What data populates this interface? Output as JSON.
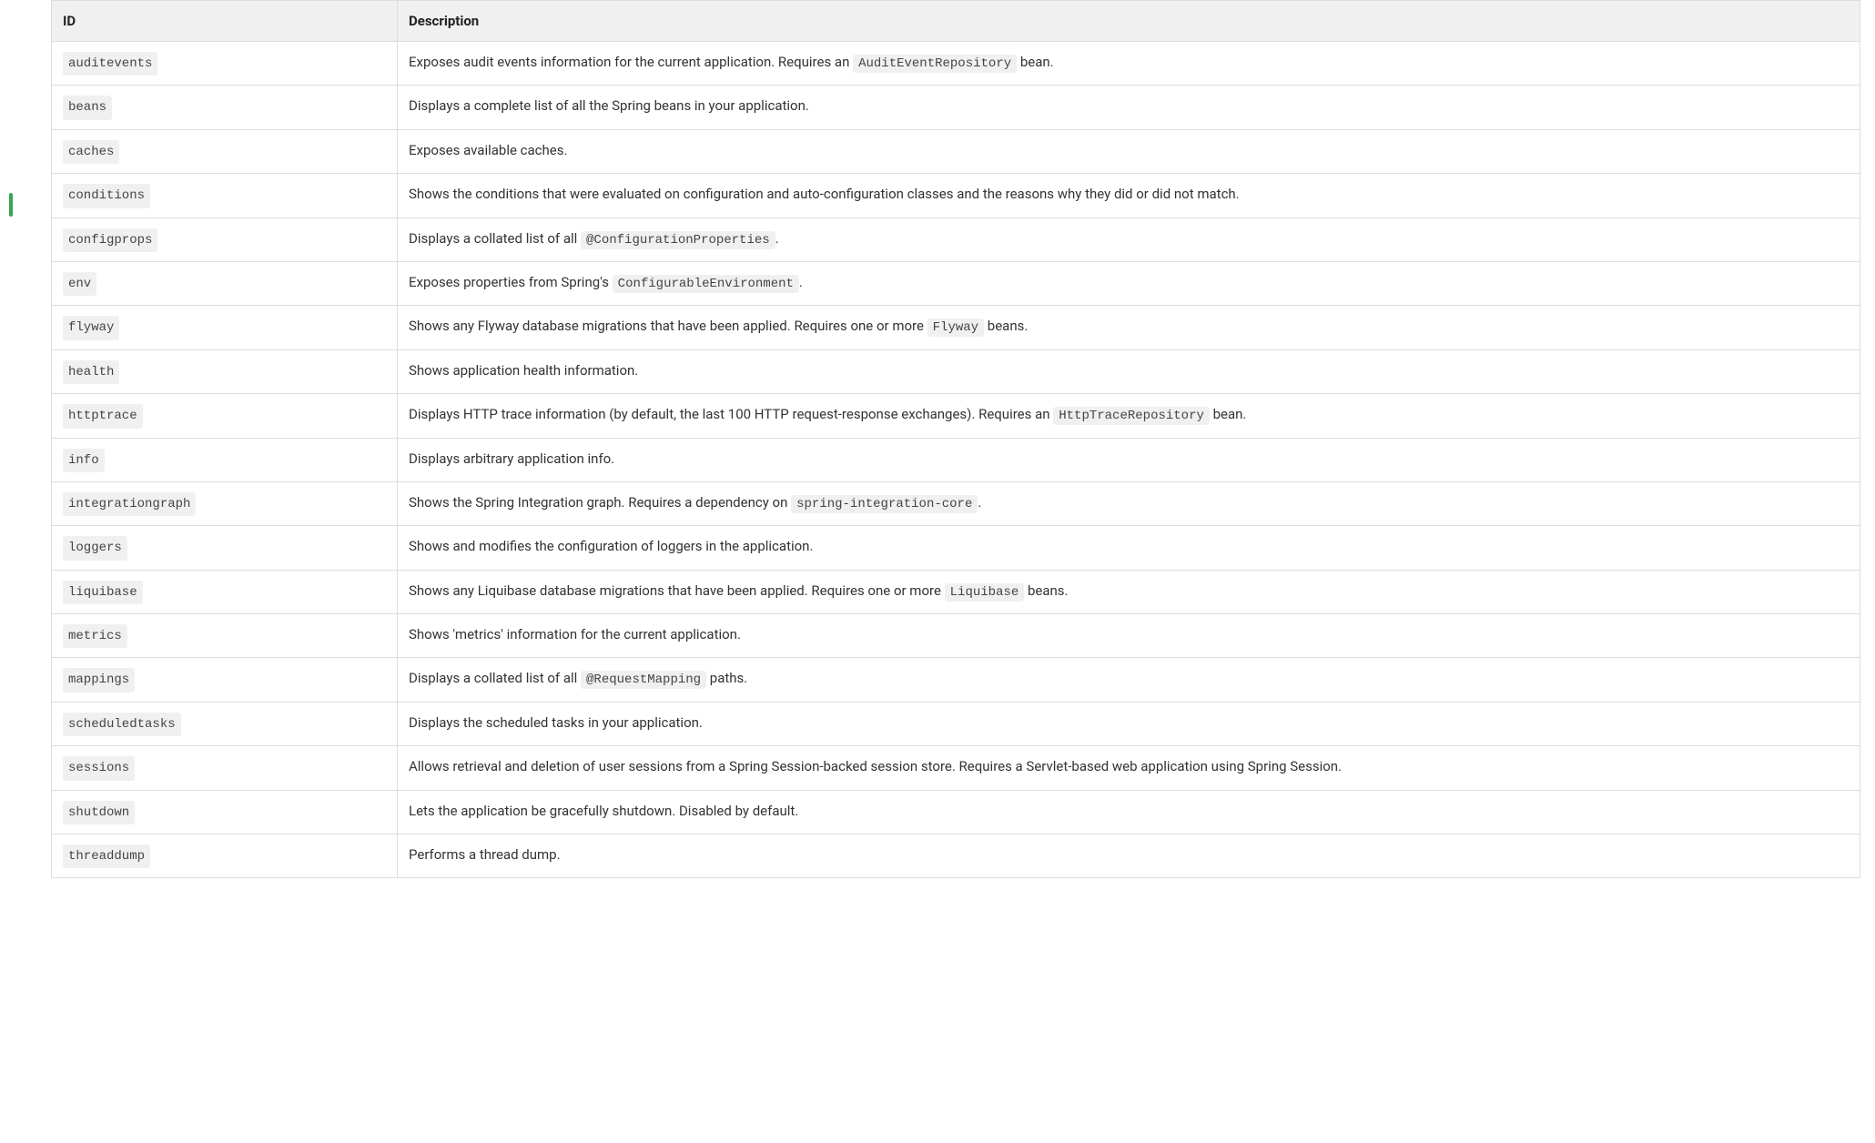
{
  "table": {
    "headers": {
      "id": "ID",
      "description": "Description"
    },
    "rows": [
      {
        "id": "auditevents",
        "desc": [
          {
            "t": "text",
            "v": "Exposes audit events information for the current application. Requires an "
          },
          {
            "t": "code",
            "v": "AuditEventRepository"
          },
          {
            "t": "text",
            "v": " bean."
          }
        ]
      },
      {
        "id": "beans",
        "desc": [
          {
            "t": "text",
            "v": "Displays a complete list of all the Spring beans in your application."
          }
        ]
      },
      {
        "id": "caches",
        "desc": [
          {
            "t": "text",
            "v": "Exposes available caches."
          }
        ]
      },
      {
        "id": "conditions",
        "desc": [
          {
            "t": "text",
            "v": "Shows the conditions that were evaluated on configuration and auto-configuration classes and the reasons why they did or did not match."
          }
        ]
      },
      {
        "id": "configprops",
        "desc": [
          {
            "t": "text",
            "v": "Displays a collated list of all "
          },
          {
            "t": "code",
            "v": "@ConfigurationProperties"
          },
          {
            "t": "text",
            "v": "."
          }
        ]
      },
      {
        "id": "env",
        "desc": [
          {
            "t": "text",
            "v": "Exposes properties from Spring's "
          },
          {
            "t": "code",
            "v": "ConfigurableEnvironment"
          },
          {
            "t": "text",
            "v": "."
          }
        ]
      },
      {
        "id": "flyway",
        "desc": [
          {
            "t": "text",
            "v": "Shows any Flyway database migrations that have been applied. Requires one or more "
          },
          {
            "t": "code",
            "v": "Flyway"
          },
          {
            "t": "text",
            "v": " beans."
          }
        ]
      },
      {
        "id": "health",
        "desc": [
          {
            "t": "text",
            "v": "Shows application health information."
          }
        ]
      },
      {
        "id": "httptrace",
        "desc": [
          {
            "t": "text",
            "v": "Displays HTTP trace information (by default, the last 100 HTTP request-response exchanges). Requires an "
          },
          {
            "t": "code",
            "v": "HttpTraceRepository"
          },
          {
            "t": "text",
            "v": " bean."
          }
        ]
      },
      {
        "id": "info",
        "desc": [
          {
            "t": "text",
            "v": "Displays arbitrary application info."
          }
        ]
      },
      {
        "id": "integrationgraph",
        "desc": [
          {
            "t": "text",
            "v": "Shows the Spring Integration graph. Requires a dependency on "
          },
          {
            "t": "code",
            "v": "spring-integration-core"
          },
          {
            "t": "text",
            "v": "."
          }
        ]
      },
      {
        "id": "loggers",
        "desc": [
          {
            "t": "text",
            "v": "Shows and modifies the configuration of loggers in the application."
          }
        ]
      },
      {
        "id": "liquibase",
        "desc": [
          {
            "t": "text",
            "v": "Shows any Liquibase database migrations that have been applied. Requires one or more "
          },
          {
            "t": "code",
            "v": "Liquibase"
          },
          {
            "t": "text",
            "v": " beans."
          }
        ]
      },
      {
        "id": "metrics",
        "desc": [
          {
            "t": "text",
            "v": "Shows 'metrics' information for the current application."
          }
        ]
      },
      {
        "id": "mappings",
        "desc": [
          {
            "t": "text",
            "v": "Displays a collated list of all "
          },
          {
            "t": "code",
            "v": "@RequestMapping"
          },
          {
            "t": "text",
            "v": " paths."
          }
        ]
      },
      {
        "id": "scheduledtasks",
        "desc": [
          {
            "t": "text",
            "v": "Displays the scheduled tasks in your application."
          }
        ]
      },
      {
        "id": "sessions",
        "desc": [
          {
            "t": "text",
            "v": "Allows retrieval and deletion of user sessions from a Spring Session-backed session store. Requires a Servlet-based web application using Spring Session."
          }
        ]
      },
      {
        "id": "shutdown",
        "desc": [
          {
            "t": "text",
            "v": "Lets the application be gracefully shutdown. Disabled by default."
          }
        ]
      },
      {
        "id": "threaddump",
        "desc": [
          {
            "t": "text",
            "v": "Performs a thread dump."
          }
        ]
      }
    ]
  }
}
